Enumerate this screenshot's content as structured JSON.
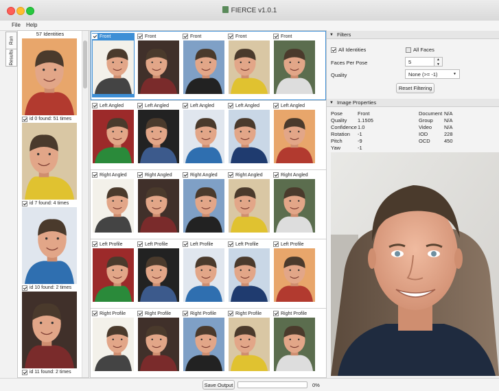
{
  "window": {
    "title": "FIERCE v1.0.1"
  },
  "menu": [
    "File",
    "Help"
  ],
  "side_tabs": [
    "Run",
    "Results"
  ],
  "identities": {
    "header": "57 Identities",
    "items": [
      {
        "label": "id 0 found: 51 times",
        "checked": true
      },
      {
        "label": "id 7 found: 4 times",
        "checked": true
      },
      {
        "label": "id 10 found: 2 times",
        "checked": true
      },
      {
        "label": "id 11 found: 2 times",
        "checked": true
      }
    ]
  },
  "poses": [
    {
      "label": "Front",
      "tiles": [
        "Front",
        "Front",
        "Front",
        "Front",
        "Front"
      ]
    },
    {
      "label": "Left Angled",
      "tiles": [
        "Left Angled",
        "Left Angled",
        "Left Angled",
        "Left Angled",
        "Left Angled"
      ]
    },
    {
      "label": "Right Angled",
      "tiles": [
        "Right Angled",
        "Right Angled",
        "Right Angled",
        "Right Angled",
        "Right Angled"
      ]
    },
    {
      "label": "Left Profile",
      "tiles": [
        "Left Profile",
        "Left Profile",
        "Left Profile",
        "Left Profile",
        "Left Profile"
      ]
    },
    {
      "label": "Right Profile",
      "tiles": [
        "Right Profile",
        "Right Profile",
        "Right Profile",
        "Right Profile",
        "Right Profile"
      ]
    }
  ],
  "filters": {
    "heading": "Filters",
    "all_identities_label": "All Identities",
    "all_identities_checked": true,
    "all_faces_label": "All Faces",
    "all_faces_checked": false,
    "faces_per_pose_label": "Faces Per Pose",
    "faces_per_pose_value": "5",
    "quality_label": "Quality",
    "quality_value": "None (>= -1)",
    "reset_label": "Reset Filtering"
  },
  "image_properties": {
    "heading": "Image Properties",
    "left": [
      {
        "key": "Pose",
        "value": "Front"
      },
      {
        "key": "Quality",
        "value": "1.1505"
      },
      {
        "key": "Confidence",
        "value": "1.0"
      },
      {
        "key": "Rotation",
        "value": "-1"
      },
      {
        "key": "Pitch",
        "value": "-9"
      },
      {
        "key": "Yaw",
        "value": "-1"
      }
    ],
    "right": [
      {
        "key": "Document",
        "value": "N/A"
      },
      {
        "key": "Group",
        "value": "N/A"
      },
      {
        "key": "Video",
        "value": "N/A"
      },
      {
        "key": "IOD",
        "value": "228"
      },
      {
        "key": "OCD",
        "value": "450"
      }
    ]
  },
  "footer": {
    "save_label": "Save Output",
    "progress_text": "0%",
    "progress": 0
  },
  "colors": {
    "accent": "#3d8fd6"
  }
}
